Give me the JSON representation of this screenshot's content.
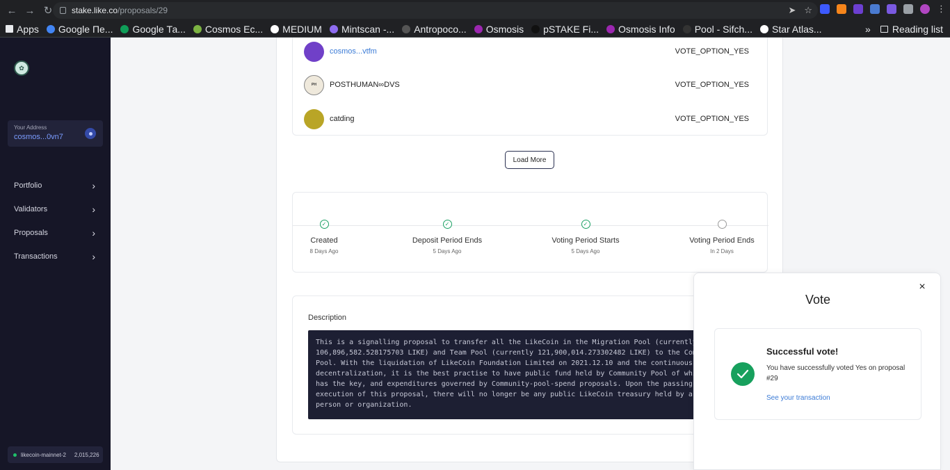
{
  "browser": {
    "url_host": "stake.like.co",
    "url_path": "/proposals/29",
    "bookmarks": [
      {
        "label": "Apps",
        "color": "#e8eaed"
      },
      {
        "label": "Google Пе...",
        "color": "#4285f4"
      },
      {
        "label": "Google Та...",
        "color": "#0f9d58"
      },
      {
        "label": "Cosmos Ec...",
        "color": "#7cb342"
      },
      {
        "label": "MEDIUM",
        "color": "#ffffff"
      },
      {
        "label": "Mintscan -...",
        "color": "#8e6cf0"
      },
      {
        "label": "Antropoco...",
        "color": "#555555"
      },
      {
        "label": "Osmosis",
        "color": "#9c27b0"
      },
      {
        "label": "pSTAKE Fi...",
        "color": "#111111"
      },
      {
        "label": "Osmosis Info",
        "color": "#9c27b0"
      },
      {
        "label": "Pool - Sifch...",
        "color": "#333333"
      },
      {
        "label": "Star Atlas...",
        "color": "#ffffff"
      }
    ],
    "more": "»",
    "reading_list": "Reading list"
  },
  "sidebar": {
    "address_label": "Your Address",
    "address_value": "cosmos...0vn7",
    "menu": [
      {
        "label": "Portfolio"
      },
      {
        "label": "Validators"
      },
      {
        "label": "Proposals"
      },
      {
        "label": "Transactions"
      }
    ],
    "network": "likecoin-mainnet-2",
    "block_height": "2,015,226"
  },
  "votes": [
    {
      "voter": "cosmos...vtfm",
      "option": "VOTE_OPTION_YES",
      "avatar_color": "#7040c8",
      "is_link": true
    },
    {
      "voter": "POSTHUMAN∞DVS",
      "option": "VOTE_OPTION_YES",
      "avatar_color": "#efe9dc",
      "is_link": false
    },
    {
      "voter": "catding",
      "option": "VOTE_OPTION_YES",
      "avatar_color": "#b9a526",
      "is_link": false
    }
  ],
  "load_more": "Load More",
  "timeline": [
    {
      "name": "Created",
      "time": "8 Days Ago",
      "done": true
    },
    {
      "name": "Deposit Period Ends",
      "time": "5 Days Ago",
      "done": true
    },
    {
      "name": "Voting Period Starts",
      "time": "5 Days Ago",
      "done": true
    },
    {
      "name": "Voting Period Ends",
      "time": "In 2 Days",
      "done": false
    }
  ],
  "description": {
    "label": "Description",
    "text": "This is a signalling proposal to transfer all the LikeCoin in the Migration Pool (currently\n106,896,582.528175703 LIKE) and Team Pool (currently 121,900,014.273302482 LIKE) to the Com\nPool. With the liquidation of LikeCoin Foundation Limited on 2021.12.10 and the continuous\ndecentralization, it is the best practise to have public fund held by Community Pool of whi\nhas the key, and expenditures governed by Community-pool-spend proposals. Upon the passing\nexecution of this proposal, there will no longer be any public LikeCoin treasury held by a\nperson or organization."
  },
  "vote_panel": {
    "title": "Vote",
    "close": "×",
    "success_title": "Successful vote!",
    "success_message": "You have successfully voted Yes on proposal #29",
    "link": "See your transaction"
  },
  "colors": {
    "sidebar_bg": "#161627",
    "success_green": "#17a05d",
    "link_blue": "#3b7bd6"
  }
}
